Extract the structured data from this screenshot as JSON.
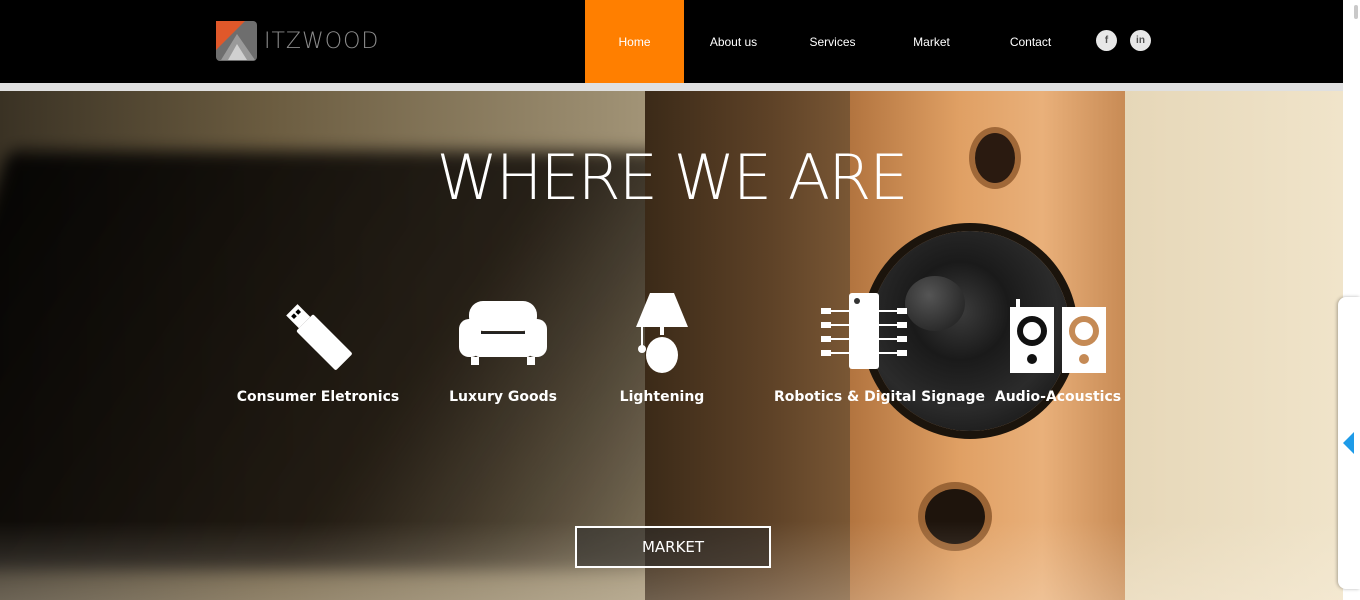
{
  "header": {
    "logo_text": "ITZWOOD",
    "nav": [
      {
        "label": "Home",
        "active": true
      },
      {
        "label": "About us",
        "active": false
      },
      {
        "label": "Services",
        "active": false
      },
      {
        "label": "Market",
        "active": false
      },
      {
        "label": "Contact",
        "active": false
      }
    ],
    "social": [
      {
        "icon": "facebook-icon",
        "glyph": "f"
      },
      {
        "icon": "linkedin-icon",
        "glyph": "in"
      }
    ]
  },
  "hero": {
    "title": "WHERE WE ARE",
    "categories": [
      {
        "label": "Consumer Eletronics",
        "icon": "usb-drive-icon"
      },
      {
        "label": "Luxury Goods",
        "icon": "sofa-icon"
      },
      {
        "label": "Lightening",
        "icon": "lamp-icon"
      },
      {
        "label": "Robotics & Digital Signage",
        "icon": "circuit-chip-icon"
      },
      {
        "label": "Audio-Acoustics",
        "icon": "speakers-icon"
      }
    ],
    "button_label": "MARKET"
  },
  "colors": {
    "accent": "#ff7f00",
    "header_bg": "#000000",
    "side_arrow": "#1e9be8"
  }
}
